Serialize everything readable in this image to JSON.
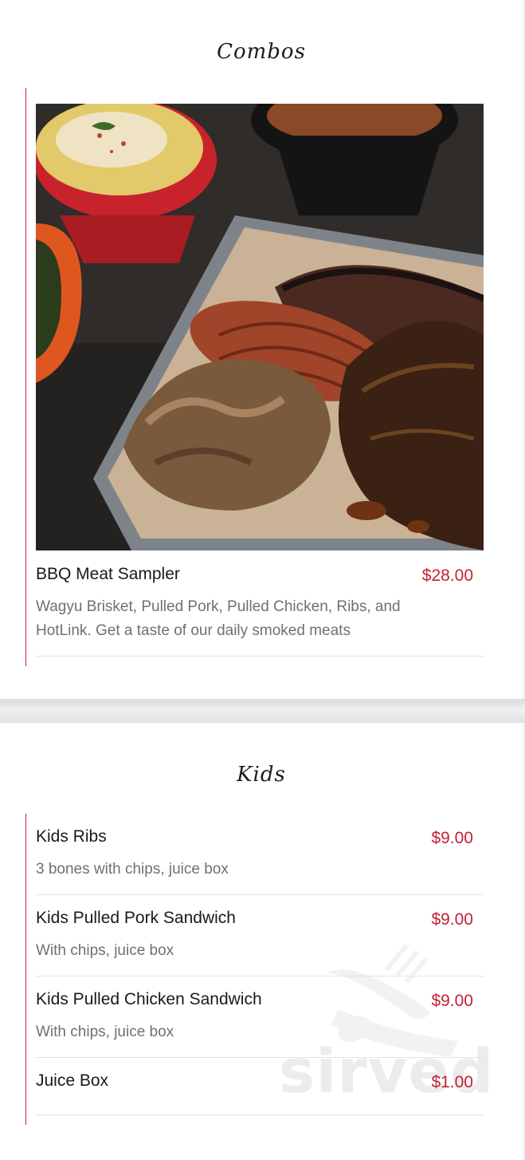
{
  "sections": [
    {
      "title": "Combos",
      "items": [
        {
          "name": "BBQ Meat Sampler",
          "price": "$28.00",
          "description": "Wagyu Brisket, Pulled Pork, Pulled Chicken, Ribs, and HotLink. Get a taste of our daily smoked meats"
        }
      ]
    },
    {
      "title": "Kids",
      "items": [
        {
          "name": "Kids Ribs",
          "price": "$9.00",
          "description": "3 bones with chips, juice box"
        },
        {
          "name": "Kids Pulled Pork Sandwich",
          "price": "$9.00",
          "description": "With chips, juice box"
        },
        {
          "name": "Kids Pulled Chicken Sandwich",
          "price": "$9.00",
          "description": "With chips, juice box"
        },
        {
          "name": "Juice Box",
          "price": "$1.00",
          "description": ""
        }
      ]
    }
  ],
  "watermark": {
    "text": "sirved",
    "icon": "fork-spoon-icon"
  },
  "colors": {
    "accent": "#c52233",
    "price": "#c52233",
    "description": "#707070"
  }
}
